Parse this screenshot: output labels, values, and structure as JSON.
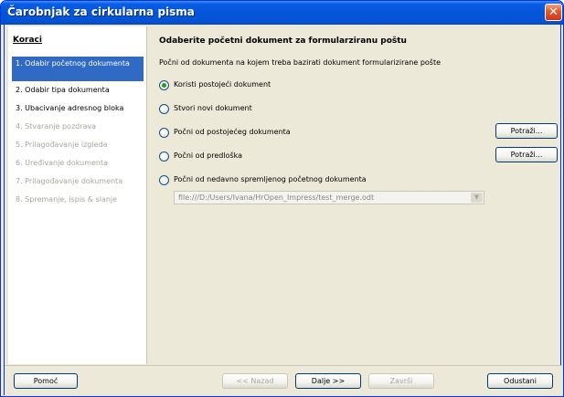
{
  "window": {
    "title": "Čarobnjak za cirkularna pisma",
    "close_glyph": "✕"
  },
  "sidebar": {
    "title": "Koraci",
    "steps": [
      {
        "label": "1. Odabir početnog dokumenta",
        "state": "active"
      },
      {
        "label": "2. Odabir tipa dokumenta",
        "state": "enabled"
      },
      {
        "label": "3. Ubacivanje adresnog bloka",
        "state": "enabled"
      },
      {
        "label": "4. Stvaranje pozdrava",
        "state": "disabled"
      },
      {
        "label": "5. Prilagođavanje izgleda",
        "state": "disabled"
      },
      {
        "label": "6. Uređivanje dokumenta",
        "state": "disabled"
      },
      {
        "label": "7. Prilagođavanje dokumenta",
        "state": "disabled"
      },
      {
        "label": "8. Spremanje, ispis & slanje",
        "state": "disabled"
      }
    ]
  },
  "main": {
    "title": "Odaberite početni dokument za formularziranu poštu",
    "description": "Počni od dokumenta na kojem treba bazirati dokument formularizirane pošte",
    "options": [
      {
        "label": "Koristi postojeći dokument",
        "checked": true
      },
      {
        "label": "Stvori novi dokument",
        "checked": false
      },
      {
        "label": "Počni od postojećeg dokumenta",
        "checked": false
      },
      {
        "label": "Počni od predloška",
        "checked": false
      },
      {
        "label": "Počni od nedavno spremljenog početnog dokumenta",
        "checked": false
      }
    ],
    "browse_button_1": "Potraži...",
    "browse_button_2": "Potraži...",
    "recent_path": "file:///D:/Users/Ivana/HrOpen_Impress/test_merge.odt"
  },
  "footer": {
    "help": "Pomoć",
    "back": "<< Nazad",
    "next": "Dalje >>",
    "finish": "Završi",
    "cancel": "Odustani"
  },
  "colors": {
    "titlebar": "#0454d8",
    "selected_step": "#316ac5",
    "dialog_bg": "#ece9d8",
    "disabled_text": "#a8a69c"
  }
}
